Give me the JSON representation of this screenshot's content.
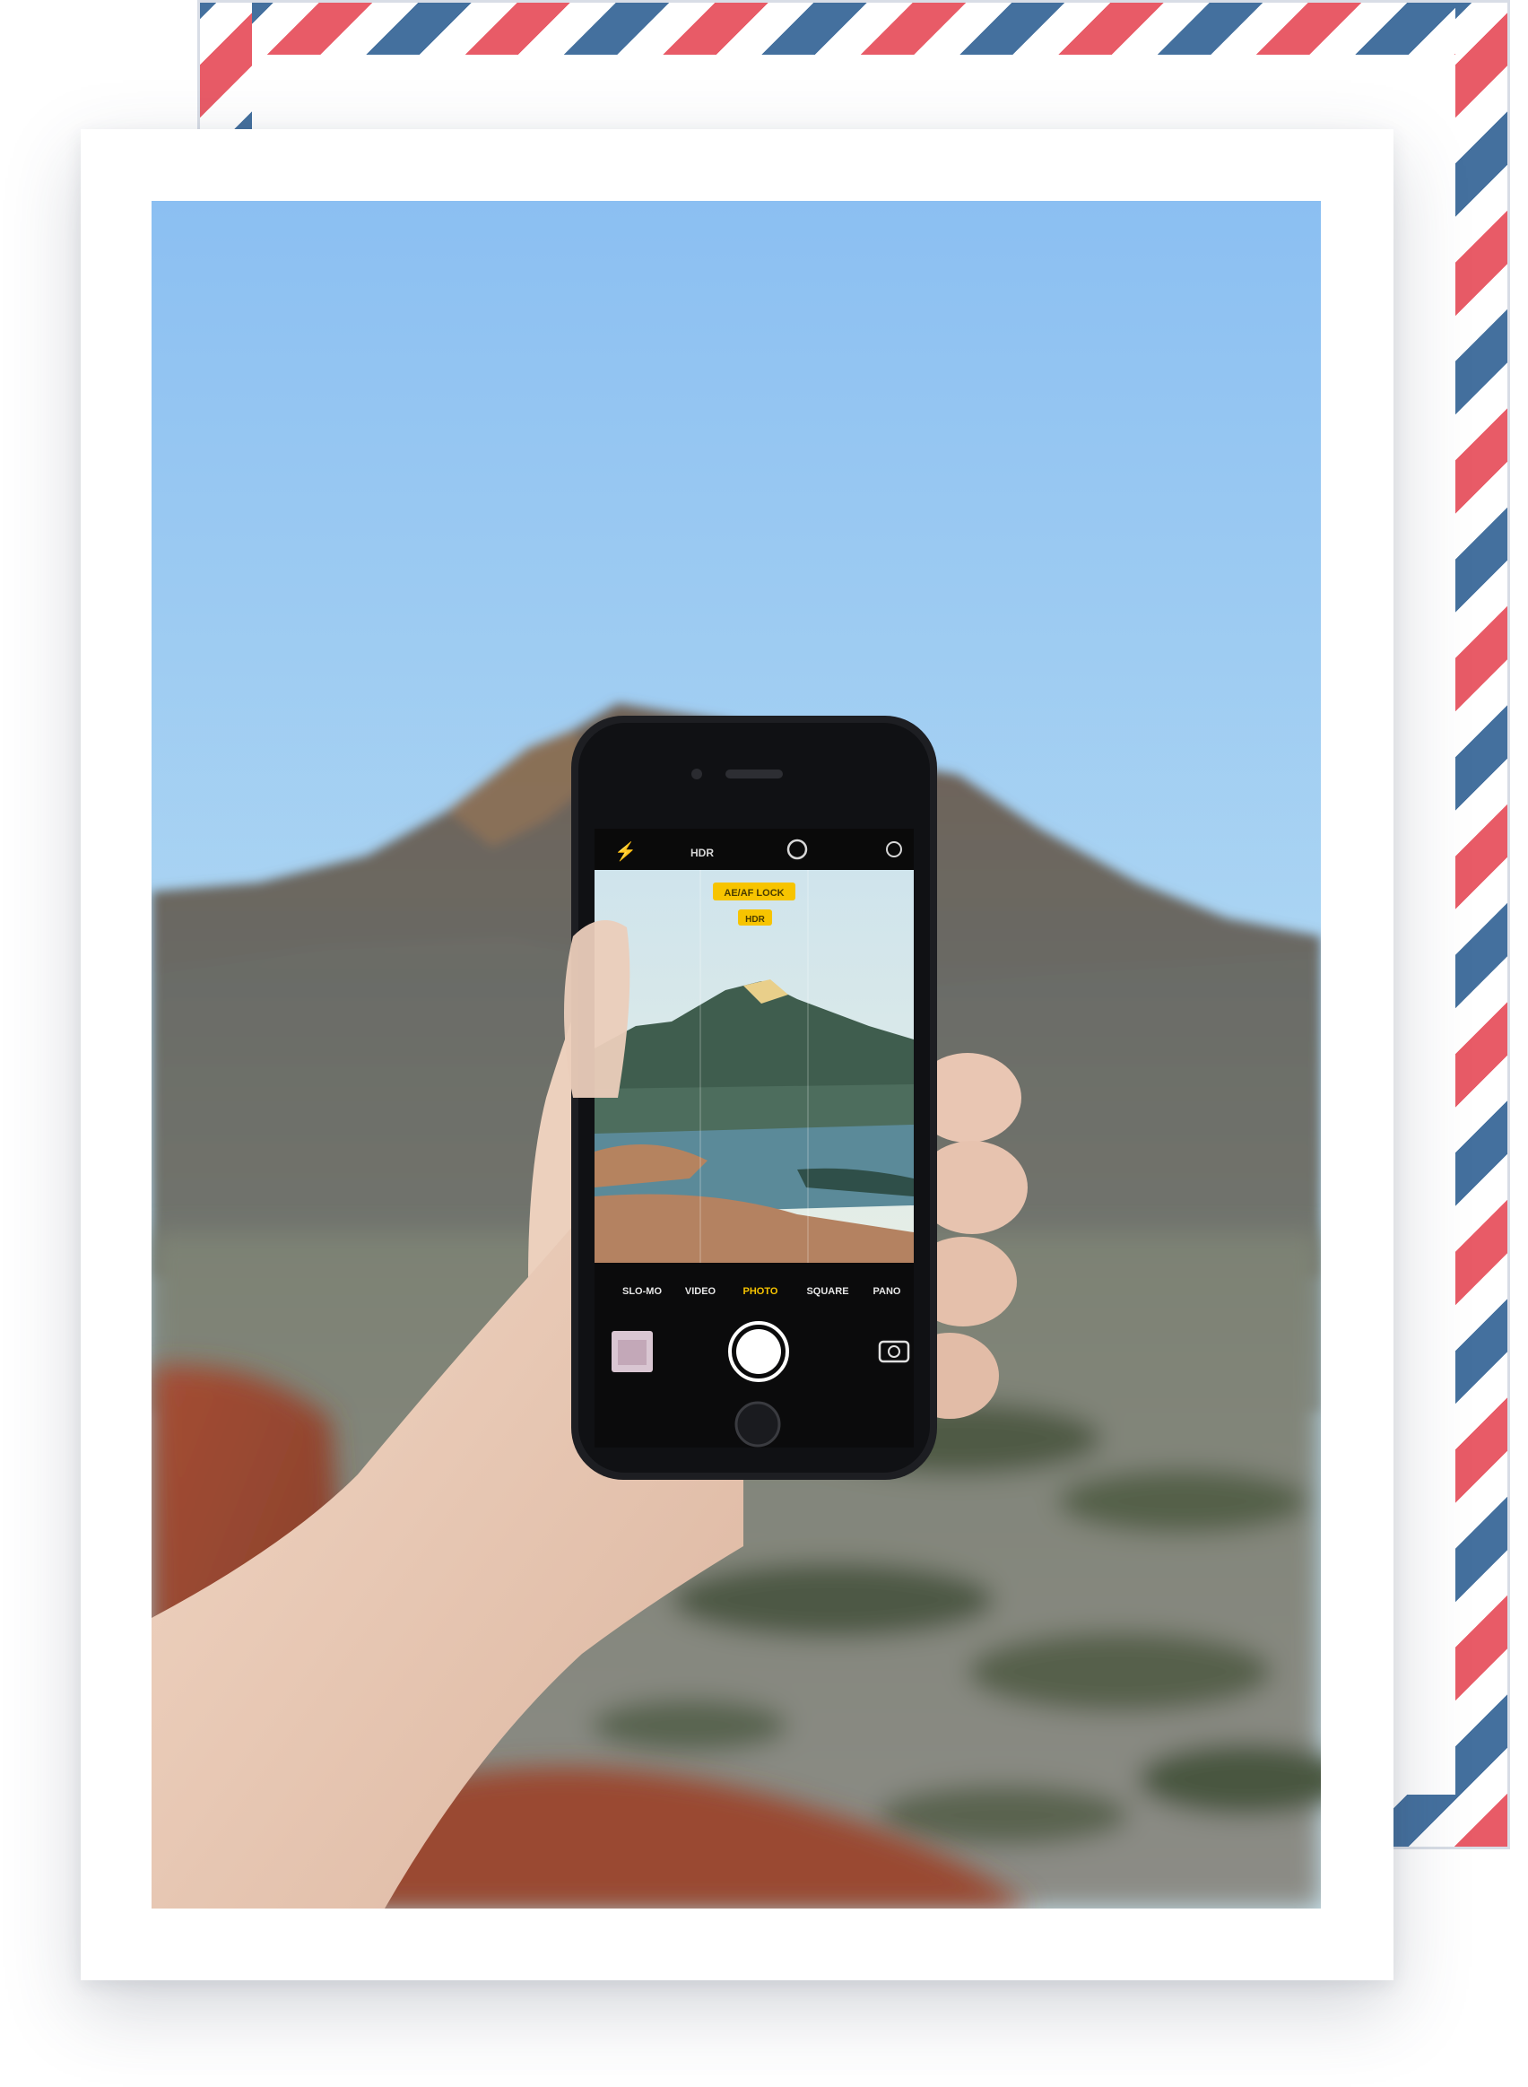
{
  "camera_ui": {
    "hdr_top": "HDR",
    "focus_lock": "AE/AF LOCK",
    "hdr_badge": "HDR",
    "modes": [
      "SLO-MO",
      "VIDEO",
      "PHOTO",
      "SQUARE",
      "PANO"
    ],
    "active_mode": "PHOTO"
  },
  "colors": {
    "stripe_red": "#e85b67",
    "stripe_blue": "#44709e",
    "sky_top": "#8ec2f4",
    "sky_bottom": "#bfe0f2",
    "ui_yellow": "#f7c400"
  },
  "icons": [
    "flash-off-icon",
    "timer-icon",
    "live-photo-icon",
    "camera-switch-icon",
    "shutter-button",
    "home-button"
  ]
}
